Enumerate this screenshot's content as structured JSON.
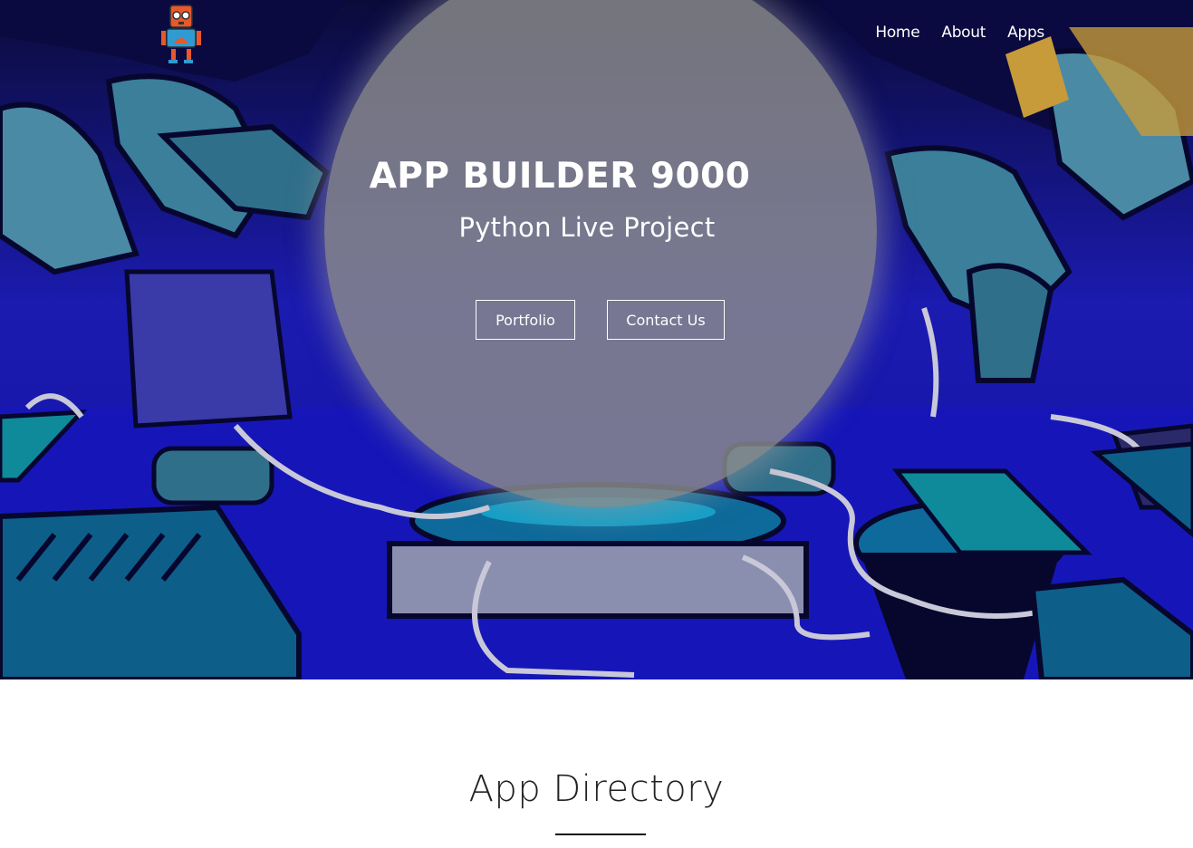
{
  "logo": {
    "icon": "robot-icon"
  },
  "nav": {
    "items": [
      "Home",
      "About",
      "Apps"
    ]
  },
  "hero": {
    "title": "APP BUILDER 9000",
    "subtitle": "Python Live Project",
    "buttons": {
      "portfolio": "Portfolio",
      "contact": "Contact Us"
    }
  },
  "directory": {
    "title": "App Directory"
  },
  "colors": {
    "hero_bg": "#1a1aa8",
    "circle_overlay": "#8c8c8c",
    "text_light": "#ffffff",
    "text_dark": "#222222"
  }
}
